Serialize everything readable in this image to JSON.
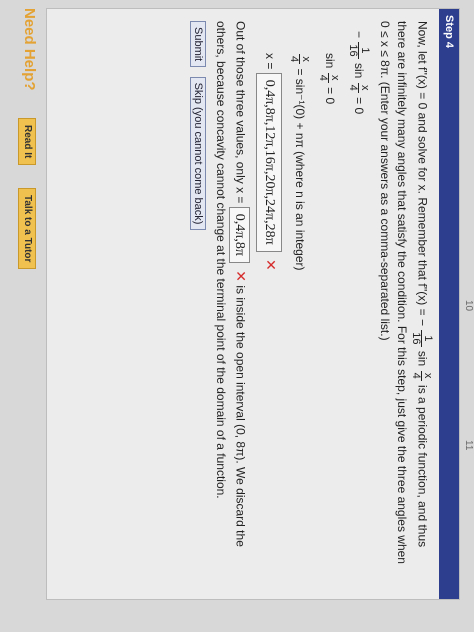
{
  "step": {
    "title": "Step 4",
    "intro_lines": [
      "Now, let  f''(x) = 0  and solve for x. Remember that  f''(x) = −",
      "sin",
      "is a periodic function, and thus",
      "there are infinitely many angles that satisfy the condition. For this step, just give the three angles when",
      "0 ≤ x ≤ 8π.  (Enter your answers as a comma-separated list.)"
    ],
    "eq1": {
      "prefix": "−",
      "frac_num": "1",
      "frac_den": "16",
      "mid": "sin",
      "x_num": "x",
      "x_den": "4",
      "suffix": "= 0"
    },
    "eq2": {
      "prefix": "sin",
      "x_num": "x",
      "x_den": "4",
      "suffix": "= 0"
    },
    "eq3": {
      "x_num": "x",
      "x_den": "4",
      "suffix": "= sin⁻¹(0) + nπ (where n is an integer)"
    },
    "eq4": {
      "prefix": "x =",
      "answer": "0,4π,8π,12π,16π,20π,24π,28π"
    },
    "conclusion": {
      "before": "Out of those three values, only  x =",
      "answer": "0,4π,8π",
      "after": "is inside the open interval  (0, 8π).  We discard the",
      "line2": "others, because concavity cannot change at the terminal point of the domain of a function."
    },
    "buttons": {
      "submit": "Submit",
      "skip": "Skip (you cannot come back)"
    }
  },
  "help": {
    "label": "Need Help?",
    "read_it": "Read It",
    "talk": "Talk to a Tutor"
  },
  "frac16": {
    "num": "1",
    "den": "16"
  },
  "frac_x4": {
    "num": "x",
    "den": "4"
  },
  "colors": {
    "header": "#2d3e8f",
    "error": "#d62b2b",
    "help": "#e3a233"
  },
  "top_scale": [
    "10",
    "11"
  ]
}
